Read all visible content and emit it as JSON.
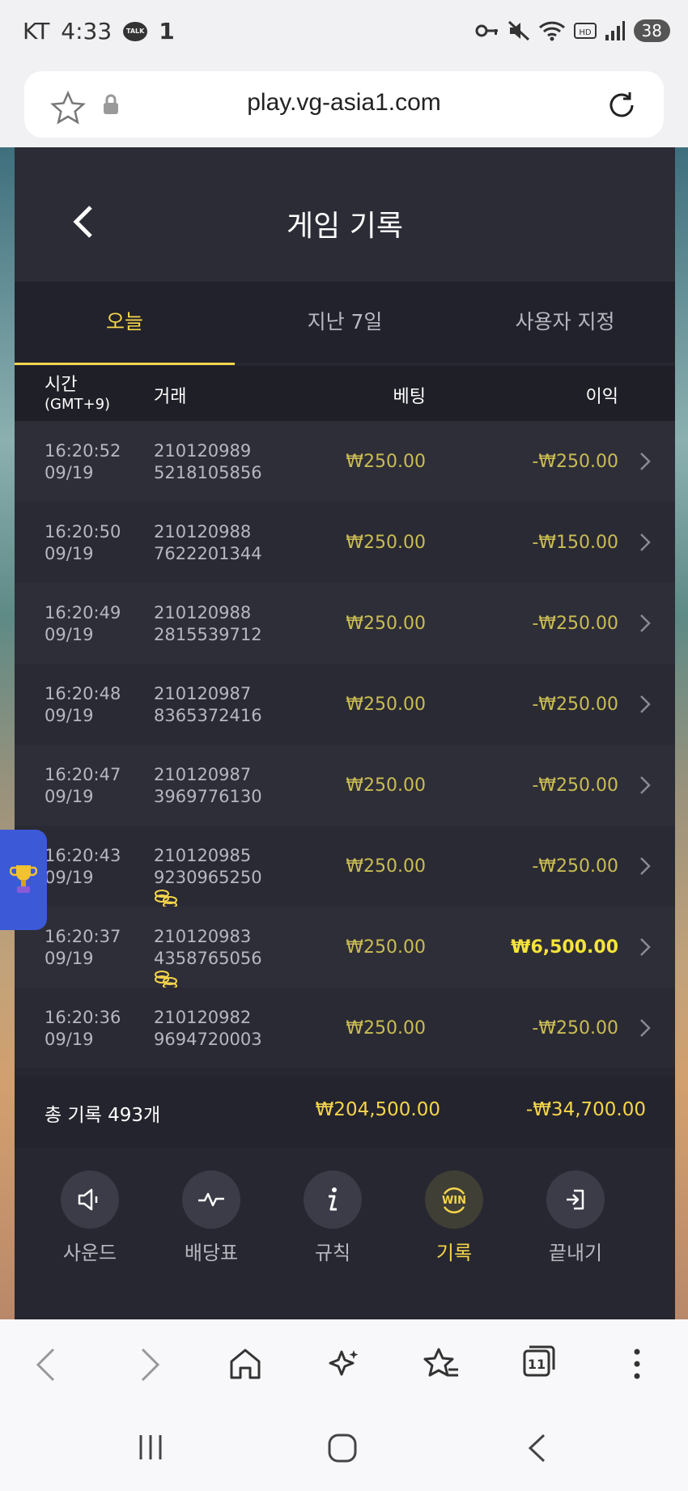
{
  "status_bar": {
    "carrier": "KT",
    "time": "4:33",
    "notif_count": "1",
    "battery": "38"
  },
  "browser": {
    "url": "play.vg-asia1.com",
    "tab_count": "11"
  },
  "page": {
    "title": "게임 기록"
  },
  "tabs": [
    {
      "label": "오늘"
    },
    {
      "label": "지난 7일"
    },
    {
      "label": "사용자 지정"
    }
  ],
  "columns": {
    "time": "시간",
    "timezone": "(GMT+9)",
    "transaction": "거래",
    "bet": "베팅",
    "profit": "이익"
  },
  "rows": [
    {
      "time": "16:20:52",
      "date": "09/19",
      "txn1": "210120989",
      "txn2": "5218105856",
      "bet": "₩250.00",
      "profit": "-₩250.00",
      "coins": false,
      "win": false
    },
    {
      "time": "16:20:50",
      "date": "09/19",
      "txn1": "210120988",
      "txn2": "7622201344",
      "bet": "₩250.00",
      "profit": "-₩150.00",
      "coins": false,
      "win": false
    },
    {
      "time": "16:20:49",
      "date": "09/19",
      "txn1": "210120988",
      "txn2": "2815539712",
      "bet": "₩250.00",
      "profit": "-₩250.00",
      "coins": false,
      "win": false
    },
    {
      "time": "16:20:48",
      "date": "09/19",
      "txn1": "210120987",
      "txn2": "8365372416",
      "bet": "₩250.00",
      "profit": "-₩250.00",
      "coins": false,
      "win": false
    },
    {
      "time": "16:20:47",
      "date": "09/19",
      "txn1": "210120987",
      "txn2": "3969776130",
      "bet": "₩250.00",
      "profit": "-₩250.00",
      "coins": false,
      "win": false
    },
    {
      "time": "16:20:43",
      "date": "09/19",
      "txn1": "210120985",
      "txn2": "9230965250",
      "bet": "₩250.00",
      "profit": "-₩250.00",
      "coins": true,
      "win": false
    },
    {
      "time": "16:20:37",
      "date": "09/19",
      "txn1": "210120983",
      "txn2": "4358765056",
      "bet": "₩250.00",
      "profit": "₩6,500.00",
      "coins": true,
      "win": true
    },
    {
      "time": "16:20:36",
      "date": "09/19",
      "txn1": "210120982",
      "txn2": "9694720003",
      "bet": "₩250.00",
      "profit": "-₩250.00",
      "coins": false,
      "win": false
    }
  ],
  "summary": {
    "label": "총 기록 493개",
    "total_bet": "₩204,500.00",
    "total_profit": "-₩34,700.00"
  },
  "footer": [
    {
      "label": "사운드",
      "icon": "speaker-icon"
    },
    {
      "label": "배당표",
      "icon": "pulse-icon"
    },
    {
      "label": "규칙",
      "icon": "info-icon"
    },
    {
      "label": "기록",
      "icon": "win-icon"
    },
    {
      "label": "끝내기",
      "icon": "exit-icon"
    }
  ],
  "colors": {
    "accent": "#f5d54a",
    "panel": "#272731",
    "amount": "#c9bc53"
  }
}
